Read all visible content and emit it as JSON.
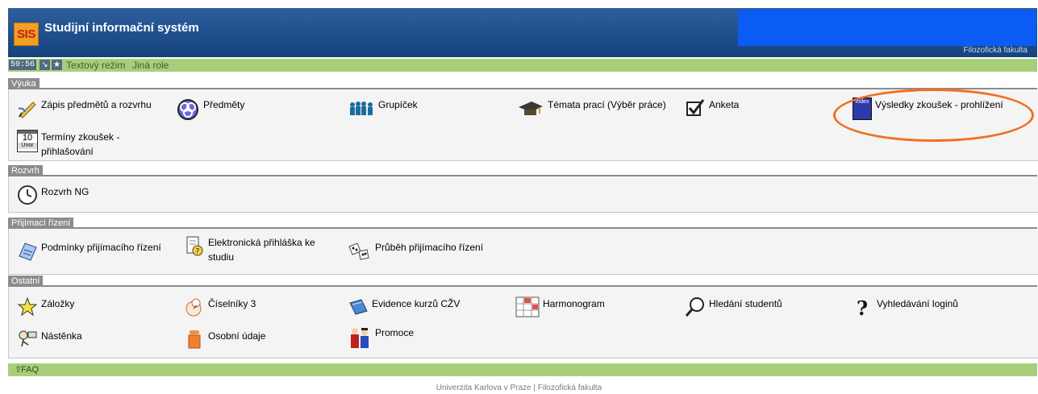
{
  "header": {
    "logo": "SIS",
    "title": "Studijní informační systém",
    "faculty_partial": "Filozofická fakulta"
  },
  "toolbar": {
    "timer": "59:56",
    "text_mode": "Textový režim",
    "other_role": "Jiná role"
  },
  "sections": {
    "vyuka": {
      "label": "Výuka",
      "items": [
        "Zápis předmětů a rozvrhu",
        "Předměty",
        "Grupíček",
        "Témata prací (Výběr práce)",
        "Anketa",
        "Výsledky zkoušek - prohlížení",
        "Termíny zkoušek - přihlašování"
      ]
    },
    "rozvrh": {
      "label": "Rozvrh",
      "items": [
        "Rozvrh NG"
      ]
    },
    "prijimaci": {
      "label": "Přijímací řízení",
      "items": [
        "Podmínky přijímacího řízení",
        "Elektronická přihláška ke studiu",
        "Průběh přijímacího řízení"
      ]
    },
    "ostatni": {
      "label": "Ostatní",
      "items": [
        "Záložky",
        "Číselníky 3",
        "Evidence kurzů CŽV",
        "Harmonogram",
        "Hledání studentů",
        "Vyhledávání loginů",
        "Nástěnka",
        "Osobní údaje",
        "Promoce"
      ]
    }
  },
  "icons": {
    "calendar_day": "10",
    "calendar_month": "Únor",
    "index_book": "Index"
  },
  "faq": "FAQ",
  "footer": "Univerzita Karlova v Praze | Filozofická fakulta",
  "colors": {
    "header_blue": "#1f4f8d",
    "toolbar_green": "#a7cf7a",
    "highlight_orange": "#f07020",
    "redaction_blue": "#0a5cf5"
  }
}
